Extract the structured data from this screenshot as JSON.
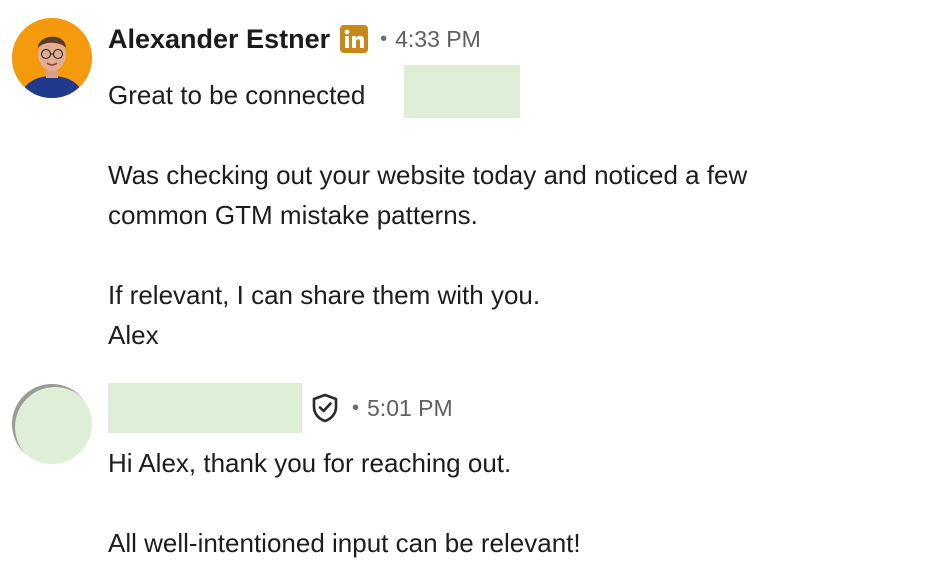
{
  "messages": [
    {
      "sender_name": "Alexander Estner",
      "badge_icon": "linkedin-icon",
      "separator": "•",
      "time": "4:33 PM",
      "lines": [
        "Great to be connected",
        "Was checking out your website today and noticed a few",
        "common GTM mistake patterns.",
        "If relevant, I can share them with you.",
        "Alex"
      ]
    },
    {
      "sender_name": "",
      "badge_icon": "shield-check-icon",
      "separator": "•",
      "time": "5:01 PM",
      "lines": [
        "Hi Alex, thank you for reaching out.",
        "All well-intentioned input can be relevant!"
      ]
    }
  ],
  "colors": {
    "linkedin_badge": "#c8871a",
    "avatar_background": "#f59a0c",
    "redaction": "#dfeed6",
    "timestamp": "#5f5f5f"
  }
}
